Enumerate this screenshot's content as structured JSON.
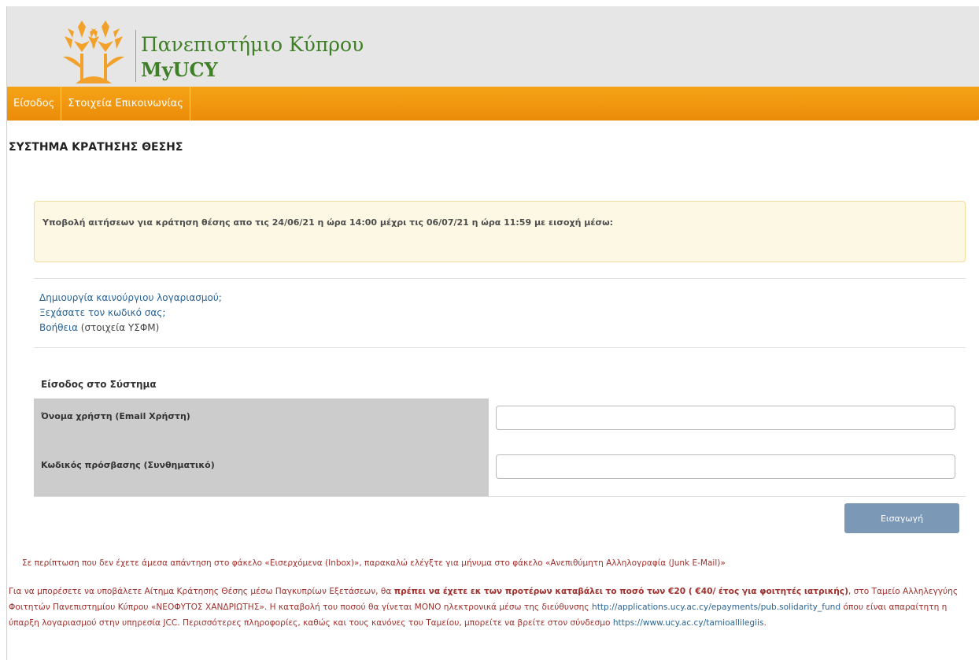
{
  "header": {
    "title": "Πανεπιστήμιο Κύπρου",
    "subtitle": "MyUCY",
    "colors": {
      "brand_green": "#3f7f28",
      "logo_orange": "#f2a12a",
      "nav_orange": "#f29b12",
      "header_bg": "#e6e6e6"
    }
  },
  "nav": {
    "items": [
      {
        "label": "Είσοδος"
      },
      {
        "label": "Στοιχεία Επικοινωνίας"
      }
    ]
  },
  "page": {
    "title": "ΣΥΣΤΗΜΑ ΚΡΑΤΗΣΗΣ ΘΕΣΗΣ"
  },
  "notice": {
    "text": "Υποβολή αιτήσεων για κράτηση θέσης απο τις 24/06/21 η ώρα 14:00 μέχρι τις 06/07/21 η ώρα 11:59 με εισοχή μέσω:"
  },
  "links": {
    "create_account": "Δημιουργία καινούργιου λογαριασμού;",
    "forgot_password": "Ξεχάσατε τον κωδικό σας;",
    "help": "Βοήθεια",
    "help_suffix": " (στοιχεία ΥΣΦΜ)"
  },
  "login": {
    "title": "Είσοδος στο Σύστημα",
    "username_label": "Όνομα χρήστη (Email Χρήστη)",
    "username_value": "",
    "password_label": "Κωδικός πρόσβασης (Συνθηματικό)",
    "password_value": "",
    "submit_label": "Εισαγωγή"
  },
  "footer": {
    "junk_notice": "Σε περίπτωση που δεν έχετε άμεσα απάντηση στο φάκελο «Εισερχόμενα (Inbox)», παρακαλώ ελέγξτε για μήνυμα στο φάκελο «Ανεπιθύμητη Αλληλογραφία (Junk E-Mail)»",
    "info_1": "Για να μπορέσετε να υποβάλετε Αίτημα Κράτησης Θέσης μέσω Παγκυπρίων Εξετάσεων, θα ",
    "info_bold": "πρέπει να έχετε εκ των προτέρων καταβάλει το ποσό των €20 ( €40/ έτος για φοιτητές ιατρικής)",
    "info_2": ", στο Ταμείο Αλληλεγγύης Φοιτητών Πανεπιστημίου Κύπρου «ΝΕΟΦΥΤΟΣ ΧΑΝΔΡΙΩΤΗΣ». Η καταβολή του ποσού θα γίνεται ΜΟΝΟ ηλεκτρονικά μέσω της διεύθυνσης ",
    "payment_link": "http://applications.ucy.ac.cy/epayments/pub.solidarity_fund",
    "info_3": " όπου είναι απαραίτητη η ύπαρξη λογαριασμού στην υπηρεσία JCC. Περισσότερες πληροφορίες, καθώς και τους κανόνες του Ταμείου, μπορείτε να βρείτε στον σύνδεσμο ",
    "rules_link": "https://www.ucy.ac.cy/tamioallilegiis",
    "info_end": "."
  }
}
